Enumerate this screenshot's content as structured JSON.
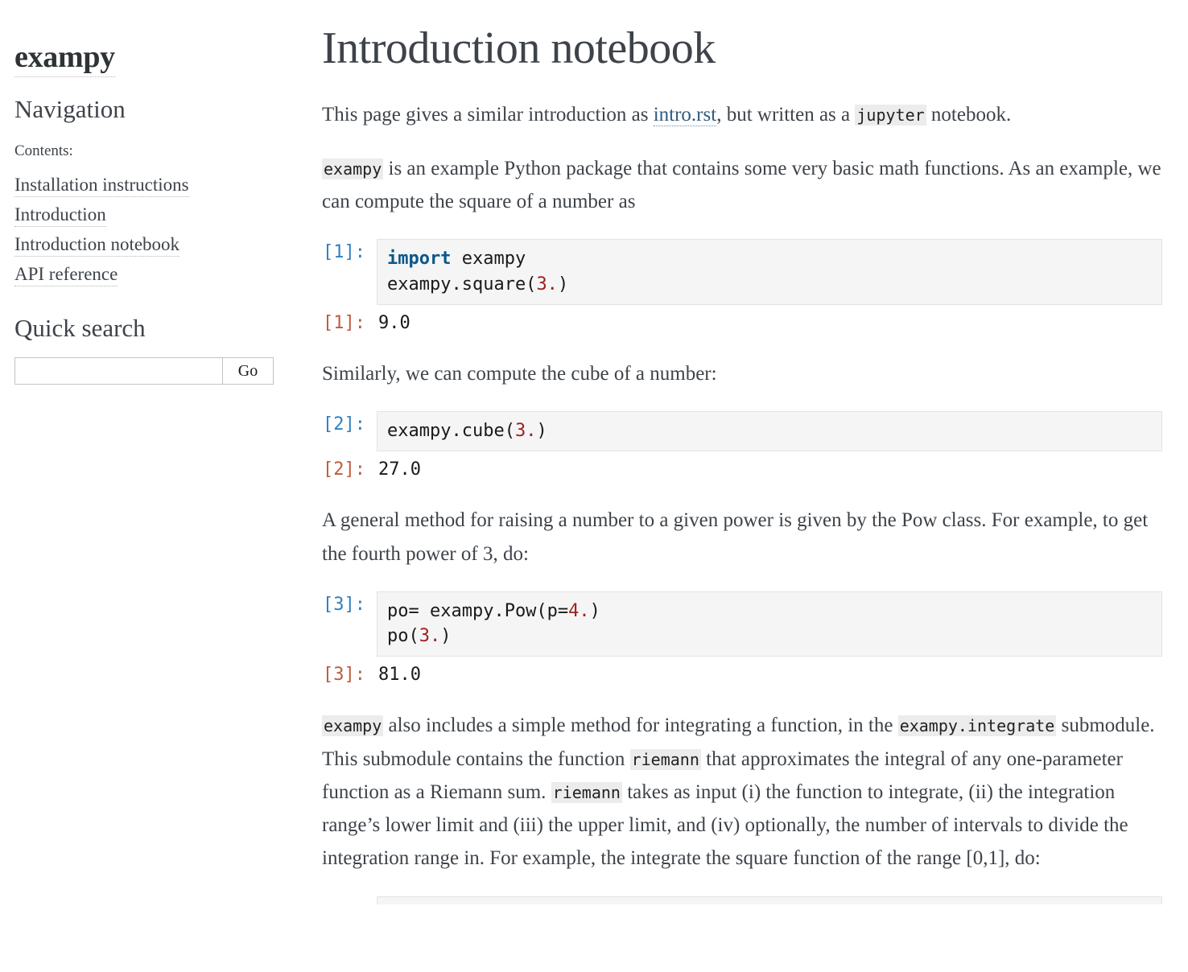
{
  "sidebar": {
    "brand": "exampy",
    "nav_title": "Navigation",
    "contents_label": "Contents:",
    "toc": [
      {
        "label": "Installation instructions"
      },
      {
        "label": "Introduction"
      },
      {
        "label": "Introduction notebook"
      },
      {
        "label": "API reference"
      }
    ],
    "search": {
      "title": "Quick search",
      "value": "",
      "placeholder": "",
      "go_label": "Go"
    }
  },
  "main": {
    "title": "Introduction notebook",
    "paragraphs": {
      "p1": {
        "part1": "This page gives a similar introduction as ",
        "link": "intro.rst",
        "part2": ", but written as a ",
        "code1": "jupyter",
        "part3": " notebook."
      },
      "p2": {
        "code1": "exampy",
        "part1": " is an example Python package that contains some very basic math functions. As an example, we can compute the square of a number as"
      },
      "p3": {
        "text": "Similarly, we can compute the cube of a number:"
      },
      "p4": {
        "text": "A general method for raising a number to a given power is given by the Pow class. For example, to get the fourth power of 3, do:"
      },
      "p5": {
        "code1": "exampy",
        "part1": " also includes a simple method for integrating a function, in the ",
        "code2": "exampy.integrate",
        "part2": " submodule. This submodule contains the function ",
        "code3": "riemann",
        "part3": " that approximates the integral of any one-parameter function as a Riemann sum. ",
        "code4": "riemann",
        "part4": " takes as input (i) the function to integrate, (ii) the integration range’s lower limit and (iii) the upper limit, and (iv) optionally, the number of intervals to divide the integration range in. For example, the integrate the square function of the range [0,1], do:"
      }
    },
    "cells": [
      {
        "in_prompt": "[1]:",
        "out_prompt": "[1]:",
        "code_lines": [
          [
            {
              "t": "import",
              "c": "kw"
            },
            {
              "t": " exampy",
              "c": "name"
            }
          ],
          [
            {
              "t": "exampy.square(",
              "c": "name"
            },
            {
              "t": "3.",
              "c": "num"
            },
            {
              "t": ")",
              "c": "op"
            }
          ]
        ],
        "output": "9.0"
      },
      {
        "in_prompt": "[2]:",
        "out_prompt": "[2]:",
        "code_lines": [
          [
            {
              "t": "exampy.cube(",
              "c": "name"
            },
            {
              "t": "3.",
              "c": "num"
            },
            {
              "t": ")",
              "c": "op"
            }
          ]
        ],
        "output": "27.0"
      },
      {
        "in_prompt": "[3]:",
        "out_prompt": "[3]:",
        "code_lines": [
          [
            {
              "t": "po= exampy.Pow(p=",
              "c": "name"
            },
            {
              "t": "4.",
              "c": "num"
            },
            {
              "t": ")",
              "c": "op"
            }
          ],
          [
            {
              "t": "po(",
              "c": "name"
            },
            {
              "t": "3.",
              "c": "num"
            },
            {
              "t": ")",
              "c": "op"
            }
          ]
        ],
        "output": "81.0"
      }
    ]
  },
  "colors": {
    "text": "#3E4349",
    "link": "#2F5B7C",
    "in_prompt": "#307FC1",
    "out_prompt": "#BF5B3D",
    "code_bg": "#f5f5f5",
    "code_border": "#e3e3e3",
    "inline_code_bg": "#ececec",
    "keyword": "#0b5789",
    "number": "#A02020"
  }
}
